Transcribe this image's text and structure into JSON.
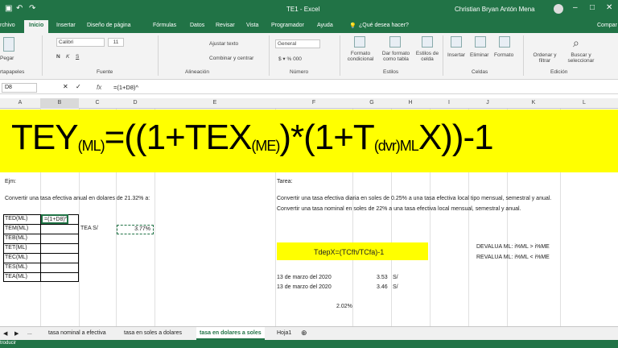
{
  "titlebar": {
    "file": "TE1 - Excel",
    "user": "Christian Bryan Antón Mena"
  },
  "tabs": [
    "rchivo",
    "Inicio",
    "Insertar",
    "Diseño de página",
    "Fórmulas",
    "Datos",
    "Revisar",
    "Vista",
    "Programador",
    "Ayuda",
    "¿Qué desea hacer?",
    "Compar"
  ],
  "ribbon": {
    "paste": "Pegar",
    "clipboard": "rtapapeles",
    "font_name": "Calibri",
    "font_size": "11",
    "font_group": "Fuente",
    "wrap": "Ajustar texto",
    "merge": "Combinar y centrar",
    "align_group": "Alineación",
    "number_format": "General",
    "number_group": "Número",
    "cond_format": "Formato condicional",
    "table_format": "Dar formato como tabla",
    "cell_styles": "Estilos de celda",
    "styles_group": "Estilos",
    "insert": "Insertar",
    "delete": "Eliminar",
    "format": "Formato",
    "cells_group": "Celdas",
    "sort": "Ordenar y filtrar",
    "find": "Buscar y seleccionar",
    "edit_group": "Edición"
  },
  "formula_bar": {
    "name": "D8",
    "fx": "fx",
    "formula": "=(1+D8)^"
  },
  "columns": [
    "A",
    "B",
    "C",
    "D",
    "E",
    "F",
    "G",
    "H",
    "I",
    "J",
    "K",
    "L"
  ],
  "banner": {
    "p1": "TEY",
    "s1": "(ML)",
    "p2": "=((1+TEX",
    "s2": "(ME)",
    "p3": ")*(1+T",
    "s3": "(dvr)ML",
    "p4": "X))-1"
  },
  "left": {
    "ejm": "Ejm:",
    "convert": "Convertir una tasa efectiva anual en dolares de 21.32% a:",
    "rows": [
      "TED(ML)",
      "TEM(ML)",
      "TEB(ML)",
      "TET(ML)",
      "TEC(ML)",
      "TES(ML)",
      "TEA(ML)"
    ],
    "editing": "=(1+D8)^",
    "tea_label": "TEA S/",
    "tea_value": "3.77%"
  },
  "right": {
    "tarea": "Tarea:",
    "t1": "Convertir una tasa efectiva diaria en soles de 0.25% a una tasa efectiva local tipo mensual, semestral y anual.",
    "t2": "Convertir una tasa nominal en soles de 22% a una tasa efectiva local mensual, semestral y anual.",
    "tdep": "TdepX=(TCfh/TCfa)-1",
    "devalua": "DEVALUA ML: i%ML > i%ME",
    "revalua": "REVALUA ML: i%ML < i%ME",
    "date1": "13 de marzo del 2020",
    "val1": "3.53",
    "cur1": "S/",
    "date2": "13 de marzo del 2020",
    "val2": "3.46",
    "cur2": "S/",
    "pct": "2.02%"
  },
  "sheets": {
    "ellipsis": "...",
    "tabs": [
      "tasa nominal a efectiva",
      "tasa en soles a dolares",
      "tasa en dolares a soles",
      "Hoja1"
    ],
    "active": 2
  },
  "status": "troducir"
}
